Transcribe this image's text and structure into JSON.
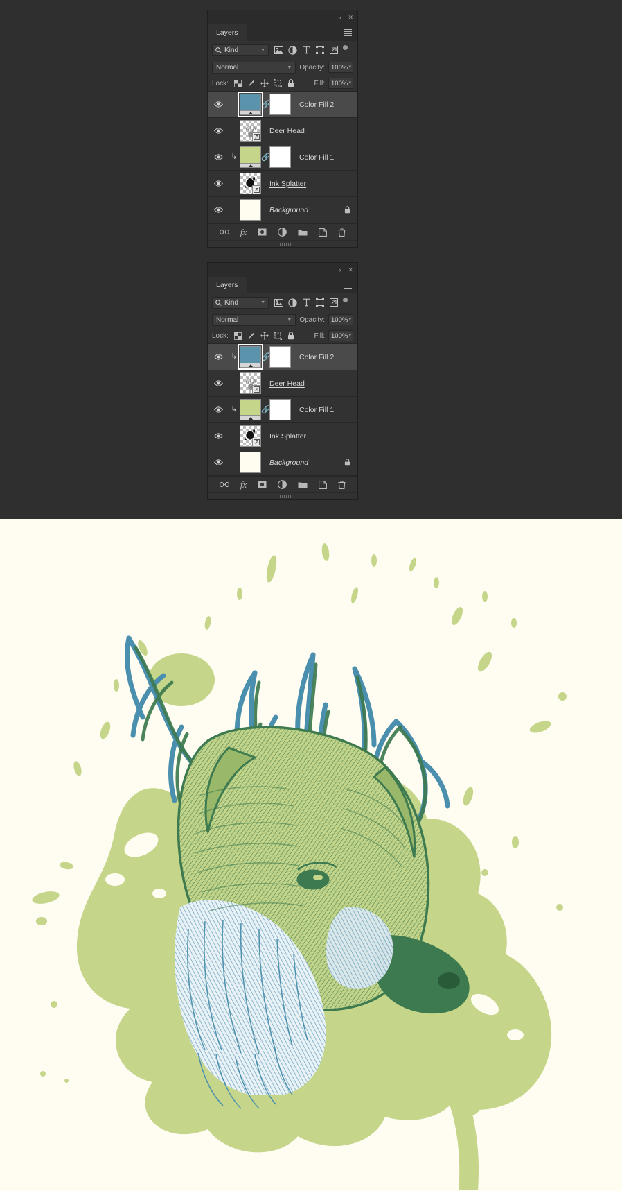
{
  "app": {
    "window_bg": "#2f2f2f",
    "canvas_bg": "#fffdf2"
  },
  "panels": [
    {
      "id": "layers-panel-top",
      "tab_label": "Layers",
      "filter": {
        "kind_label": "Kind",
        "icons": [
          "pixel-layer-filter-icon",
          "adjustment-layer-filter-icon",
          "type-layer-filter-icon",
          "shape-layer-filter-icon",
          "smart-object-filter-icon"
        ]
      },
      "blend": {
        "mode": "Normal",
        "opacity_label": "Opacity:",
        "opacity_value": "100%"
      },
      "lock": {
        "label": "Lock:",
        "icons": [
          "lock-transparent-pixels-icon",
          "lock-image-pixels-icon",
          "lock-position-icon",
          "lock-artboard-nesting-icon",
          "lock-all-icon"
        ],
        "fill_label": "Fill:",
        "fill_value": "100%"
      },
      "layers": [
        {
          "name": "Color Fill 2",
          "visible": true,
          "selected": true,
          "clipped": false,
          "thumb_type": "solid",
          "thumb_color": "#5a93ab",
          "has_mask": true,
          "mask_color": "#ffffff",
          "linked": true,
          "italic": false,
          "underlined": false,
          "locked": false,
          "thumb_selected": true
        },
        {
          "name": "Deer Head",
          "visible": true,
          "selected": false,
          "clipped": false,
          "thumb_type": "checker-art",
          "thumb_color": "#8d8d8d",
          "has_mask": false,
          "linked": false,
          "italic": false,
          "underlined": false,
          "locked": false,
          "smart_object": true,
          "thumb_selected": false
        },
        {
          "name": "Color Fill 1",
          "visible": true,
          "selected": false,
          "clipped": true,
          "thumb_type": "solid",
          "thumb_color": "#c5d68a",
          "has_mask": true,
          "mask_color": "#ffffff",
          "linked": true,
          "italic": false,
          "underlined": false,
          "locked": false,
          "thumb_selected": false
        },
        {
          "name": "Ink Splatter",
          "visible": true,
          "selected": false,
          "clipped": false,
          "thumb_type": "checker-splat",
          "thumb_color": "#111111",
          "has_mask": false,
          "linked": false,
          "italic": false,
          "underlined": true,
          "locked": false,
          "smart_object": true,
          "thumb_selected": false
        },
        {
          "name": "Background",
          "visible": true,
          "selected": false,
          "clipped": false,
          "thumb_type": "solid-plain",
          "thumb_color": "#fffdf0",
          "has_mask": false,
          "linked": false,
          "italic": true,
          "underlined": false,
          "locked": true,
          "thumb_selected": false
        }
      ],
      "bottom_icons": [
        "link-layers-icon",
        "layer-style-fx-icon",
        "add-layer-mask-icon",
        "new-adjustment-layer-icon",
        "new-group-icon",
        "new-layer-icon",
        "delete-layer-icon"
      ]
    },
    {
      "id": "layers-panel-bottom",
      "tab_label": "Layers",
      "filter": {
        "kind_label": "Kind",
        "icons": [
          "pixel-layer-filter-icon",
          "adjustment-layer-filter-icon",
          "type-layer-filter-icon",
          "shape-layer-filter-icon",
          "smart-object-filter-icon"
        ]
      },
      "blend": {
        "mode": "Normal",
        "opacity_label": "Opacity:",
        "opacity_value": "100%"
      },
      "lock": {
        "label": "Lock:",
        "icons": [
          "lock-transparent-pixels-icon",
          "lock-image-pixels-icon",
          "lock-position-icon",
          "lock-artboard-nesting-icon",
          "lock-all-icon"
        ],
        "fill_label": "Fill:",
        "fill_value": "100%"
      },
      "layers": [
        {
          "name": "Color Fill 2",
          "visible": true,
          "selected": true,
          "clipped": true,
          "thumb_type": "solid",
          "thumb_color": "#5a93ab",
          "has_mask": true,
          "mask_color": "#ffffff",
          "linked": true,
          "italic": false,
          "underlined": false,
          "locked": false,
          "thumb_selected": true
        },
        {
          "name": "Deer Head",
          "visible": true,
          "selected": false,
          "clipped": false,
          "thumb_type": "checker-art",
          "thumb_color": "#8d8d8d",
          "has_mask": false,
          "linked": false,
          "italic": false,
          "underlined": true,
          "locked": false,
          "smart_object": true,
          "thumb_selected": false
        },
        {
          "name": "Color Fill 1",
          "visible": true,
          "selected": false,
          "clipped": true,
          "thumb_type": "solid",
          "thumb_color": "#c5d68a",
          "has_mask": true,
          "mask_color": "#ffffff",
          "linked": true,
          "italic": false,
          "underlined": false,
          "locked": false,
          "thumb_selected": false
        },
        {
          "name": "Ink Splatter",
          "visible": true,
          "selected": false,
          "clipped": false,
          "thumb_type": "checker-splat",
          "thumb_color": "#111111",
          "has_mask": false,
          "linked": false,
          "italic": false,
          "underlined": true,
          "locked": false,
          "smart_object": true,
          "thumb_selected": false
        },
        {
          "name": "Background",
          "visible": true,
          "selected": false,
          "clipped": false,
          "thumb_type": "solid-plain",
          "thumb_color": "#fffdf0",
          "has_mask": false,
          "linked": false,
          "italic": true,
          "underlined": false,
          "locked": true,
          "thumb_selected": false
        }
      ],
      "bottom_icons": [
        "link-layers-icon",
        "layer-style-fx-icon",
        "add-layer-mask-icon",
        "new-adjustment-layer-icon",
        "new-group-icon",
        "new-layer-icon",
        "delete-layer-icon"
      ]
    }
  ],
  "artwork": {
    "title": "Deer Head Ink Splatter Composite",
    "palette": {
      "paper": "#fffdf2",
      "green": "#c5d68a",
      "dark_green": "#3d7a4f",
      "teal": "#4a8fad",
      "mid_green": "#6f9b52"
    }
  }
}
